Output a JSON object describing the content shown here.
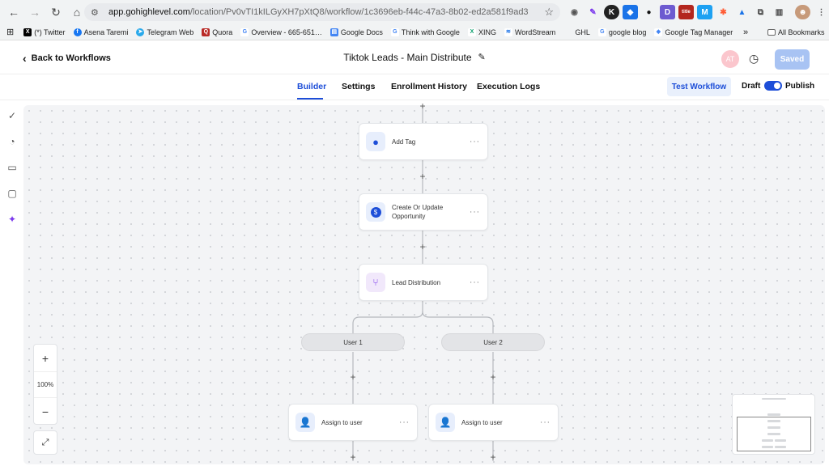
{
  "browser": {
    "url_host": "app.gohighlevel.com",
    "url_path": "/location/Pv0vTI1kILGyXH7pXtQ8/workflow/1c3696eb-f44c-47a3-8b02-ed2a581f9ad3",
    "bookmarks": [
      "(*) Twitter",
      "Asena Taremi",
      "Telegram Web",
      "Quora",
      "Overview - 665-651…",
      "Google Docs",
      "Think with Google",
      "XING",
      "WordStream",
      "GHL",
      "google blog",
      "Google Tag Manager"
    ],
    "all_bookmarks": "All Bookmarks"
  },
  "header": {
    "back_label": "Back to Workflows",
    "title": "Tiktok Leads - Main Distribute",
    "avatar_initials": "AT",
    "saved_label": "Saved"
  },
  "tabs": [
    "Builder",
    "Settings",
    "Enrollment History",
    "Execution Logs"
  ],
  "active_tab": "Builder",
  "toolbar": {
    "test_label": "Test Workflow",
    "draft_label": "Draft",
    "publish_label": "Publish",
    "publish_on": true
  },
  "nodes": {
    "add_tag": "Add Tag",
    "create_opportunity_line1": "Create Or Update",
    "create_opportunity_line2": "Opportunity",
    "lead_distribution": "Lead Distribution",
    "branch_user1": "User 1",
    "branch_user2": "User 2",
    "assign_user1": "Assign to user",
    "assign_user2": "Assign to user"
  },
  "zoom": {
    "level": "100%",
    "zoom_in": "+",
    "zoom_out": "−"
  },
  "colors": {
    "accent": "#1d4ed8",
    "saved_bg": "#a8c3f3",
    "tag_icon_bg": "#e7eefc",
    "opp_icon_bg": "#e7eefc",
    "dist_icon_bg": "#f1e8fb"
  },
  "icons": {
    "sidebar": [
      "check-circle-icon",
      "pie-chart-icon",
      "chat-icon",
      "note-icon",
      "sparkle-icon"
    ]
  }
}
